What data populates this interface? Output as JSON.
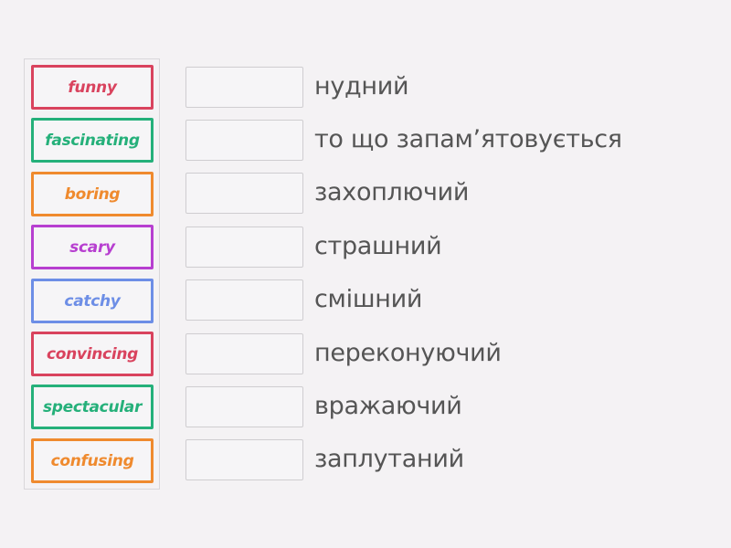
{
  "activity": {
    "type": "match-up",
    "tiles": [
      {
        "text": "funny",
        "color": "#d9435e"
      },
      {
        "text": "fascinating",
        "color": "#25b07a"
      },
      {
        "text": "boring",
        "color": "#ef8a2e"
      },
      {
        "text": "scary",
        "color": "#b73fd0"
      },
      {
        "text": "catchy",
        "color": "#6d8ee6"
      },
      {
        "text": "convincing",
        "color": "#d9435e"
      },
      {
        "text": "spectacular",
        "color": "#25b07a"
      },
      {
        "text": "confusing",
        "color": "#ef8a2e"
      }
    ],
    "definitions": [
      {
        "text": "нудний"
      },
      {
        "text": "то що запам’ятовується"
      },
      {
        "text": "захоплючий"
      },
      {
        "text": "страшний"
      },
      {
        "text": "смішний"
      },
      {
        "text": "переконуючий"
      },
      {
        "text": "вражаючий"
      },
      {
        "text": "заплутаний"
      }
    ],
    "text_color": "#555555"
  }
}
